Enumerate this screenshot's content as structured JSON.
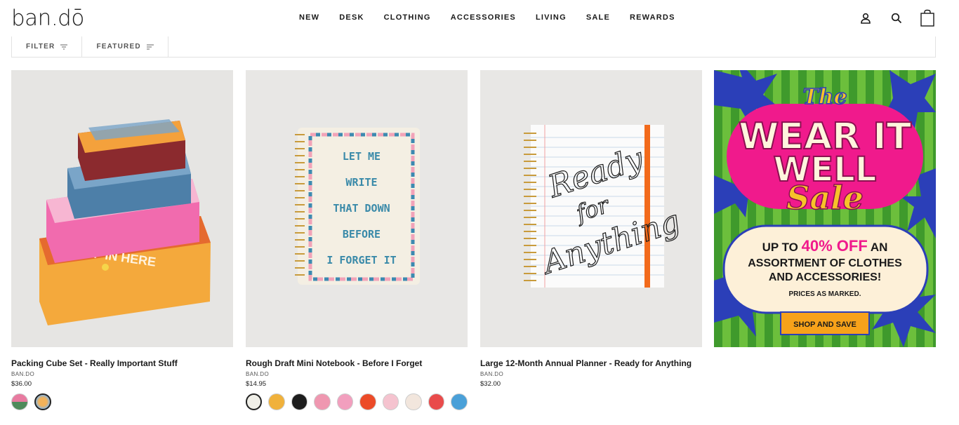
{
  "header": {
    "logo": "ban.dō",
    "nav": [
      "NEW",
      "DESK",
      "CLOTHING",
      "ACCESSORIES",
      "LIVING",
      "SALE",
      "REWARDS"
    ],
    "icons": [
      "account-icon",
      "search-icon",
      "bag-icon"
    ]
  },
  "filters": {
    "filter_label": "FILTER",
    "sort_label": "FEATURED"
  },
  "products": [
    {
      "title": "Packing Cube Set - Really Important Stuff",
      "brand": "BAN.DO",
      "price": "$36.00",
      "image_text": "STUFF IN HERE",
      "swatches": [
        "#e87aa0",
        "#f2b25a"
      ]
    },
    {
      "title": "Rough Draft Mini Notebook - Before I Forget",
      "brand": "BAN.DO",
      "price": "$14.95",
      "image_lines": [
        "LET ME",
        "WRITE",
        "THAT DOWN",
        "BEFORE",
        "I FORGET IT"
      ],
      "swatches": [
        "#f0efe8",
        "#f0b13b",
        "#1d1d1d",
        "#ef97b0",
        "#f29fbe",
        "#ec4b28",
        "#f5c3cf",
        "#f2e6dd",
        "#e94b4b",
        "#4aa0d8"
      ]
    },
    {
      "title": "Large 12-Month Annual Planner - Ready for Anything",
      "brand": "BAN.DO",
      "price": "$32.00",
      "image_lines": [
        "Ready",
        "for",
        "Anything"
      ]
    }
  ],
  "promo": {
    "line1": "The",
    "line2": "WEAR IT",
    "line3": "WELL",
    "line4": "Sale",
    "offer_pre": "UP TO",
    "offer_pct": "40% OFF",
    "offer_post": "AN",
    "offer_rest1": "ASSORTMENT OF CLOTHES",
    "offer_rest2": "AND ACCESSORIES!",
    "note": "PRICES AS MARKED.",
    "cta": "SHOP AND SAVE"
  }
}
